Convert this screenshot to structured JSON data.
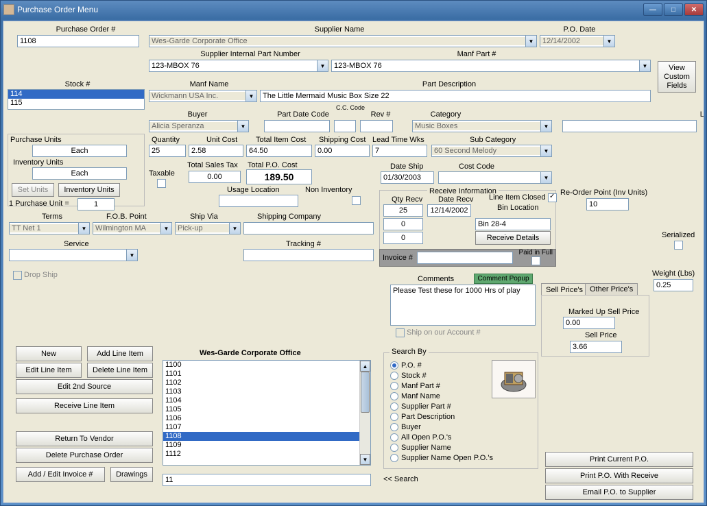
{
  "window": {
    "title": "Purchase Order Menu"
  },
  "labels": {
    "po_num": "Purchase Order #",
    "supplier_name": "Supplier Name",
    "po_date": "P.O. Date",
    "supplier_part": "Supplier Internal Part Number",
    "manf_part": "Manf Part #",
    "stock_num": "Stock #",
    "manf_name": "Manf Name",
    "part_desc": "Part Description",
    "buyer": "Buyer",
    "part_date_code": "Part Date Code",
    "cc_code": "C.C. Code",
    "rev": "Rev #",
    "category": "Category",
    "lot": "Lot #",
    "purchase_units": "Purchase Units",
    "quantity": "Quantity",
    "unit_cost": "Unit Cost",
    "total_item": "Total Item Cost",
    "shipping_cost": "Shipping Cost",
    "lead_time": "Lead Time Wks",
    "sub_category": "Sub Category",
    "inv_units": "Inventory Units",
    "taxable": "Taxable",
    "total_tax": "Total Sales Tax",
    "total_po": "Total P.O. Cost",
    "date_ship": "Date Ship",
    "cost_code": "Cost Code",
    "usage_loc": "Usage Location",
    "non_inv": "Non Inventory",
    "recv_info": "Receive Information",
    "qty_recv": "Qty Recv",
    "date_recv": "Date Recv",
    "line_closed": "Line Item Closed",
    "bin_loc": "Bin Location",
    "reorder": "Re-Order Point (Inv Units)",
    "terms": "Terms",
    "fob": "F.O.B. Point",
    "ship_via": "Ship Via",
    "shipping_co": "Shipping Company",
    "service": "Service",
    "tracking": "Tracking #",
    "invoice": "Invoice #",
    "paid_full": "Paid in Full",
    "drop_ship": "Drop Ship",
    "comments": "Comments",
    "comment_popup": "Comment Popup",
    "ship_account": "Ship on our Account #",
    "sell_prices": "Sell Price's",
    "other_prices": "Other Price's",
    "marked_up": "Marked Up Sell Price",
    "sell_price": "Sell Price",
    "serialized": "Serialized",
    "weight": "Weight (Lbs)",
    "search_by": "Search By",
    "search": "<< Search",
    "pu_eq": "1 Purchase Unit ="
  },
  "buttons": {
    "view_custom": "View Custom Fields",
    "set_units": "Set Units",
    "inv_units_btn": "Inventory Units",
    "recv_details": "Receive Details",
    "new": "New",
    "add_line": "Add Line Item",
    "edit_line": "Edit Line Item",
    "delete_line": "Delete Line Item",
    "edit_2nd": "Edit 2nd  Source",
    "recv_line": "Receive Line Item",
    "return_vendor": "Return To Vendor",
    "delete_po": "Delete Purchase Order",
    "add_invoice": "Add / Edit Invoice #",
    "drawings": "Drawings",
    "print_po": "Print Current P.O.",
    "print_recv": "Print P.O. With Receive",
    "email_po": "Email P.O. to Supplier"
  },
  "values": {
    "po_num": "1108",
    "supplier_name": "Wes-Garde Corporate Office",
    "po_date": "12/14/2002",
    "supplier_part": "123-MBOX 76",
    "manf_part": "123-MBOX 76",
    "manf_name": "Wickmann USA Inc.",
    "part_desc": "The Little Mermaid Music Box Size 22",
    "buyer": "Alicia Speranza",
    "category": "Music Boxes",
    "purchase_units": "Each",
    "quantity": "25",
    "unit_cost": "2.58",
    "total_item": "64.50",
    "shipping_cost": "0.00",
    "lead_time": "7",
    "sub_category": "60 Second Melody",
    "inv_units": "Each",
    "total_tax": "0.00",
    "total_po": "189.50",
    "date_ship": "01/30/2003",
    "pu_eq": "1",
    "terms": "TT Net 1",
    "fob": "Wilmington MA",
    "ship_via": "Pick-up",
    "qty_recv_1": "25",
    "qty_recv_2": "0",
    "qty_recv_3": "0",
    "date_recv": "12/14/2002",
    "bin_loc": "Bin 28-4",
    "reorder": "10",
    "weight": "0.25",
    "marked_up": "0.00",
    "sell_price": "3.66",
    "comments": "Please Test these for 1000 Hrs of play",
    "list_title": "Wes-Garde Corporate Office",
    "search_input": "11"
  },
  "stock_items": [
    "114",
    "115"
  ],
  "po_list": [
    "1100",
    "1101",
    "1102",
    "1103",
    "1104",
    "1105",
    "1106",
    "1107",
    "1108",
    "1109",
    "1112"
  ],
  "po_selected": "1108",
  "search_opts": [
    "P.O. #",
    "Stock #",
    "Manf Part #",
    "Manf Name",
    "Supplier Part #",
    "Part Description",
    "Buyer",
    "All Open P.O.'s",
    "Supplier Name",
    "Supplier Name Open P.O.'s"
  ],
  "search_sel": 0
}
